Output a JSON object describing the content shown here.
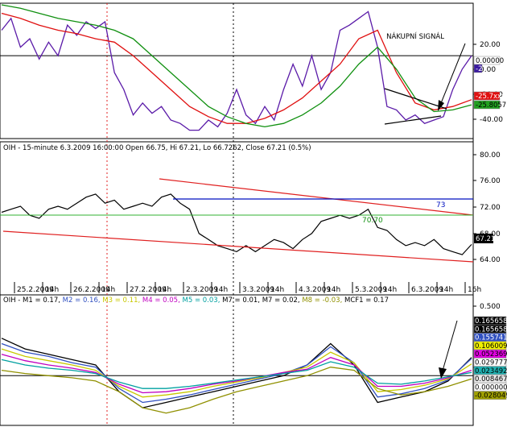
{
  "colors": {
    "purple": "#5a1aa8",
    "red": "#e01010",
    "green": "#109010",
    "black": "#000000",
    "blue": "#0010c0",
    "trendred": "#e02020",
    "hline_green": "#30b030"
  },
  "panel1": {
    "annotation": "NÁKUPNÍ SIGNÁL",
    "ticks": [
      "20.00",
      "0.00",
      "-20.00",
      "-40.00"
    ],
    "boxes": [
      {
        "text": "0.00000",
        "bg": "#ffffff",
        "fg": "#000000"
      },
      {
        "text": "-2",
        "bg": "#3a1aa0",
        "fg": "#ffffff"
      },
      {
        "text": "-25.7xxx",
        "bg": "#e01010",
        "fg": "#ffffff"
      },
      {
        "text": "-25.8057",
        "bg": "#20a020",
        "fg": "#000000"
      }
    ]
  },
  "panel2": {
    "header": "OIH - 15-minute 6.3.2009 16:00:00 Open 66.75, Hi 67.21, Lo 66.7262, Close 67.21 (0.5%)",
    "ticks": [
      "80.00",
      "76.00",
      "72.00",
      "68.00",
      "64.00"
    ],
    "price_box": "67.21",
    "blue_label": "73",
    "green_label": "70.70",
    "xlabels": [
      "25.2.2009",
      "14h",
      "26.2.2009",
      "14h",
      "27.2.2009",
      "14h",
      "2.3.2009",
      "14h",
      "3.3.2009",
      "14h",
      "4.3.2009",
      "14h",
      "5.3.2009",
      "14h",
      "6.3.2009",
      "14h",
      "16h"
    ]
  },
  "panel3": {
    "header": [
      {
        "text": "OIH - M1 = 0.17, ",
        "color": "#000000"
      },
      {
        "text": "M2 = 0.16, ",
        "color": "#3050c0"
      },
      {
        "text": "M3 = 0.11, ",
        "color": "#c8c800"
      },
      {
        "text": "M4 = 0.05, ",
        "color": "#c000c0"
      },
      {
        "text": "M5 = 0.03, ",
        "color": "#00a0a0"
      },
      {
        "text": "M7 = 0.01, M7 = 0.02, ",
        "color": "#000000"
      },
      {
        "text": "M8 = -0.03, ",
        "color": "#909000"
      },
      {
        "text": "MCF1 = 0.17",
        "color": "#000000"
      }
    ],
    "ticks": [
      "0.500",
      "0.000"
    ],
    "boxes": [
      {
        "text": "0.165658",
        "bg": "#000000",
        "fg": "#ffffff"
      },
      {
        "text": "0.165658",
        "bg": "#000000",
        "fg": "#ffffff"
      },
      {
        "text": "0.155741",
        "bg": "#3050c0",
        "fg": "#ffffff"
      },
      {
        "text": "0.106009",
        "bg": "#f0f000",
        "fg": "#000000"
      },
      {
        "text": "0.052369",
        "bg": "#e000e0",
        "fg": "#000000"
      },
      {
        "text": "0.029777",
        "bg": "#ffffff",
        "fg": "#000000"
      },
      {
        "text": "0.023492",
        "bg": "#20b0b0",
        "fg": "#000000"
      },
      {
        "text": "0.008467",
        "bg": "#e8e8e8",
        "fg": "#000000"
      },
      {
        "text": "0.000000",
        "bg": "#ffffff",
        "fg": "#000000"
      },
      {
        "text": "-0.028049",
        "bg": "#a0a000",
        "fg": "#000000"
      }
    ]
  },
  "chart_data": [
    {
      "type": "line",
      "title": "",
      "ylim": [
        -48,
        30
      ],
      "xlim": [
        0,
        100
      ],
      "hline": 0,
      "series": [
        {
          "color": "#5a1aa8",
          "x": [
            0,
            2,
            4,
            6,
            8,
            10,
            12,
            14,
            16,
            18,
            20,
            22,
            24,
            26,
            28,
            30,
            32,
            34,
            36,
            38,
            40,
            42,
            44,
            46,
            48,
            50,
            52,
            54,
            56,
            58,
            60,
            62,
            64,
            66,
            68,
            70,
            72,
            74,
            76,
            78,
            80,
            82,
            84,
            86,
            88,
            90,
            92,
            94,
            96,
            98,
            100
          ],
          "y": [
            15,
            22,
            5,
            10,
            -2,
            8,
            0,
            18,
            12,
            20,
            16,
            20,
            -10,
            -20,
            -35,
            -28,
            -34,
            -30,
            -38,
            -40,
            -44,
            -44,
            -38,
            -42,
            -34,
            -20,
            -35,
            -40,
            -30,
            -38,
            -20,
            -5,
            -18,
            0,
            -20,
            -10,
            15,
            18,
            22,
            26,
            5,
            -30,
            -32,
            -38,
            -35,
            -40,
            -38,
            -36,
            -20,
            -8,
            0
          ]
        },
        {
          "color": "#e01010",
          "x": [
            0,
            4,
            8,
            12,
            16,
            20,
            24,
            28,
            32,
            36,
            40,
            44,
            48,
            52,
            56,
            60,
            64,
            68,
            72,
            76,
            80,
            84,
            88,
            92,
            96,
            100
          ],
          "y": [
            25,
            22,
            18,
            15,
            13,
            10,
            8,
            0,
            -10,
            -20,
            -30,
            -36,
            -40,
            -40,
            -37,
            -32,
            -25,
            -15,
            -5,
            10,
            15,
            -10,
            -28,
            -32,
            -30,
            -26
          ]
        },
        {
          "color": "#109010",
          "x": [
            0,
            4,
            8,
            12,
            16,
            20,
            24,
            28,
            32,
            36,
            40,
            44,
            48,
            52,
            56,
            60,
            64,
            68,
            72,
            76,
            80,
            84,
            88,
            92,
            96,
            100
          ],
          "y": [
            30,
            28,
            25,
            22,
            20,
            18,
            15,
            10,
            0,
            -10,
            -20,
            -30,
            -36,
            -40,
            -42,
            -40,
            -35,
            -28,
            -18,
            -5,
            5,
            -8,
            -25,
            -33,
            -32,
            -29
          ]
        }
      ]
    },
    {
      "type": "line",
      "title": "",
      "ylim": [
        61,
        82
      ],
      "xlim": [
        0,
        100
      ],
      "series": [
        {
          "name": "OIH",
          "color": "#000000",
          "x": [
            0,
            2,
            4,
            6,
            8,
            10,
            12,
            14,
            16,
            18,
            20,
            22,
            24,
            26,
            28,
            30,
            32,
            34,
            36,
            38,
            40,
            42,
            44,
            46,
            48,
            50,
            52,
            54,
            56,
            58,
            60,
            62,
            64,
            66,
            68,
            70,
            72,
            74,
            76,
            78,
            80,
            82,
            84,
            86,
            88,
            90,
            92,
            94,
            96,
            98,
            100
          ],
          "y": [
            72.5,
            73,
            73.5,
            72,
            71.5,
            73,
            73.5,
            73,
            74,
            75,
            75.5,
            74,
            74.5,
            73,
            73.5,
            74,
            73.5,
            75,
            75.5,
            74,
            73,
            69,
            68,
            67,
            66.5,
            66,
            67,
            66,
            67,
            68,
            67.5,
            66.5,
            68,
            69,
            71,
            71.5,
            72,
            71.5,
            72,
            73,
            70,
            69.5,
            68,
            67,
            67.5,
            67,
            68,
            66.5,
            66,
            65.5,
            67.2
          ]
        }
      ]
    },
    {
      "type": "line",
      "title": "",
      "ylim": [
        -0.45,
        0.65
      ],
      "xlim": [
        0,
        100
      ],
      "hline": 0,
      "series": [
        {
          "name": "M1",
          "color": "#000000",
          "x": [
            0,
            5,
            10,
            15,
            20,
            25,
            30,
            35,
            40,
            45,
            50,
            55,
            60,
            65,
            70,
            75,
            80,
            85,
            90,
            95,
            100
          ],
          "y": [
            0.35,
            0.25,
            0.2,
            0.15,
            0.1,
            -0.15,
            -0.3,
            -0.25,
            -0.2,
            -0.15,
            -0.1,
            -0.05,
            0.0,
            0.1,
            0.3,
            0.1,
            -0.25,
            -0.2,
            -0.15,
            -0.05,
            0.17
          ]
        },
        {
          "name": "M2",
          "color": "#3050c0",
          "x": [
            0,
            5,
            10,
            15,
            20,
            25,
            30,
            35,
            40,
            45,
            50,
            55,
            60,
            65,
            70,
            75,
            80,
            85,
            90,
            95,
            100
          ],
          "y": [
            0.3,
            0.22,
            0.18,
            0.12,
            0.08,
            -0.12,
            -0.25,
            -0.22,
            -0.18,
            -0.13,
            -0.08,
            -0.03,
            0.02,
            0.1,
            0.27,
            0.12,
            -0.2,
            -0.17,
            -0.12,
            -0.04,
            0.16
          ]
        },
        {
          "name": "M3",
          "color": "#c8c800",
          "x": [
            0,
            5,
            10,
            15,
            20,
            25,
            30,
            35,
            40,
            45,
            50,
            55,
            60,
            65,
            70,
            75,
            80,
            85,
            90,
            95,
            100
          ],
          "y": [
            0.25,
            0.18,
            0.14,
            0.1,
            0.05,
            -0.1,
            -0.2,
            -0.18,
            -0.15,
            -0.1,
            -0.06,
            -0.02,
            0.03,
            0.08,
            0.22,
            0.12,
            -0.15,
            -0.13,
            -0.09,
            -0.03,
            0.11
          ]
        },
        {
          "name": "M4",
          "color": "#c000c0",
          "x": [
            0,
            5,
            10,
            15,
            20,
            25,
            30,
            35,
            40,
            45,
            50,
            55,
            60,
            65,
            70,
            75,
            80,
            85,
            90,
            95,
            100
          ],
          "y": [
            0.2,
            0.14,
            0.1,
            0.07,
            0.03,
            -0.08,
            -0.16,
            -0.15,
            -0.12,
            -0.08,
            -0.05,
            -0.01,
            0.03,
            0.06,
            0.17,
            0.1,
            -0.1,
            -0.1,
            -0.07,
            -0.02,
            0.05
          ]
        },
        {
          "name": "M5",
          "color": "#00a0a0",
          "x": [
            0,
            5,
            10,
            15,
            20,
            25,
            30,
            35,
            40,
            45,
            50,
            55,
            60,
            65,
            70,
            75,
            80,
            85,
            90,
            95,
            100
          ],
          "y": [
            0.15,
            0.1,
            0.07,
            0.05,
            0.02,
            -0.06,
            -0.12,
            -0.12,
            -0.1,
            -0.07,
            -0.04,
            -0.01,
            0.02,
            0.05,
            0.13,
            0.08,
            -0.07,
            -0.08,
            -0.05,
            -0.01,
            0.03
          ]
        },
        {
          "name": "M8",
          "color": "#909000",
          "x": [
            0,
            5,
            10,
            15,
            20,
            25,
            30,
            35,
            40,
            45,
            50,
            55,
            60,
            65,
            70,
            75,
            80,
            85,
            90,
            95,
            100
          ],
          "y": [
            0.05,
            0.02,
            0.0,
            -0.02,
            -0.05,
            -0.15,
            -0.3,
            -0.35,
            -0.3,
            -0.22,
            -0.15,
            -0.1,
            -0.05,
            0.0,
            0.08,
            0.05,
            -0.12,
            -0.18,
            -0.15,
            -0.1,
            -0.03
          ]
        }
      ]
    }
  ]
}
